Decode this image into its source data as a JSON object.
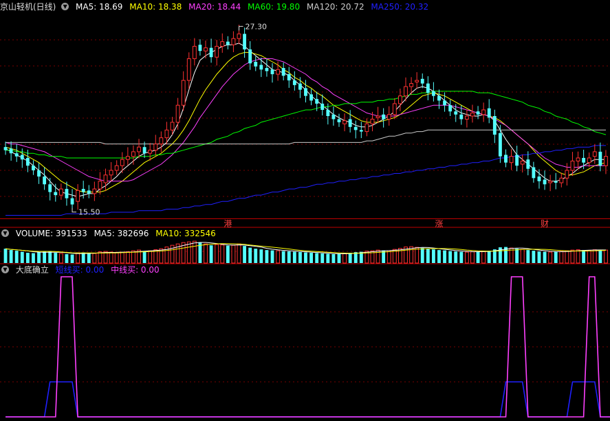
{
  "colors": {
    "background": "#000000",
    "up": "#ff3232",
    "down": "#54ffff",
    "grid": "#8b0000",
    "ma5": "#ffffff",
    "ma10": "#ffff00",
    "ma20": "#ff40ff",
    "ma60": "#00ff00",
    "ma120": "#cccccc",
    "ma250": "#2020ff",
    "short_buy": "#2020ff",
    "mid_buy": "#ff40ff",
    "tag": "#ff4040"
  },
  "price_panel": {
    "title": "京山轻机(日线)",
    "legend": [
      {
        "key": "ma5",
        "label": "MA5: 18.69",
        "color": "#ffffff"
      },
      {
        "key": "ma10",
        "label": "MA10: 18.38",
        "color": "#ffff00"
      },
      {
        "key": "ma20",
        "label": "MA20: 18.44",
        "color": "#ff40ff"
      },
      {
        "key": "ma60",
        "label": "MA60: 19.80",
        "color": "#00ff00"
      },
      {
        "key": "ma120",
        "label": "MA120: 20.72",
        "color": "#cccccc"
      },
      {
        "key": "ma250",
        "label": "MA250: 20.32",
        "color": "#2020ff"
      }
    ],
    "high_label": "27.30",
    "low_label": "15.50",
    "tags": [
      "港",
      "涨",
      "财"
    ]
  },
  "volume_panel": {
    "legend": [
      {
        "key": "volume",
        "label": "VOLUME: 391533",
        "color": "#ffffff"
      },
      {
        "key": "vma5",
        "label": "MA5: 382696",
        "color": "#ffffff"
      },
      {
        "key": "vma10",
        "label": "MA10: 332546",
        "color": "#ffff00"
      }
    ]
  },
  "indicator_panel": {
    "title": "大底确立",
    "legend": [
      {
        "key": "short_buy",
        "label": "短线买: 0.00",
        "color": "#2020ff"
      },
      {
        "key": "mid_buy",
        "label": "中线买: 0.00",
        "color": "#ff40ff"
      }
    ]
  },
  "chart_data": {
    "type": "candlestick",
    "price": {
      "high": 27.3,
      "low": 15.5,
      "ylim": [
        15.0,
        28.2
      ],
      "closes": [
        19.4,
        19.2,
        19.0,
        18.8,
        18.4,
        18.1,
        17.7,
        17.2,
        16.7,
        16.5,
        16.9,
        16.3,
        15.9,
        16.8,
        16.7,
        16.6,
        16.9,
        17.4,
        17.8,
        18.1,
        18.4,
        18.8,
        19.0,
        19.3,
        19.6,
        19.2,
        19.4,
        19.8,
        20.2,
        20.7,
        21.2,
        22.3,
        23.9,
        25.3,
        26.1,
        25.8,
        26.0,
        25.4,
        26.1,
        26.4,
        26.2,
        26.6,
        26.9,
        25.9,
        25.0,
        24.8,
        24.6,
        24.5,
        24.3,
        24.6,
        24.2,
        23.9,
        23.6,
        23.3,
        22.9,
        22.6,
        22.4,
        22.0,
        21.6,
        21.4,
        21.2,
        21.3,
        20.9,
        20.7,
        20.6,
        21.1,
        21.4,
        21.6,
        21.4,
        21.7,
        22.4,
        22.9,
        23.5,
        23.7,
        23.9,
        23.7,
        23.1,
        22.9,
        22.6,
        22.3,
        21.9,
        21.7,
        21.4,
        21.6,
        21.8,
        21.7,
        22.0,
        21.5,
        20.4,
        19.0,
        18.6,
        19.0,
        18.4,
        18.7,
        18.2,
        17.6,
        17.4,
        17.2,
        17.4,
        17.3,
        17.6,
        18.1,
        18.7,
        18.9,
        18.6,
        18.9,
        19.3,
        18.4,
        19.0
      ],
      "opens": [
        19.6,
        19.5,
        19.2,
        19.1,
        18.9,
        18.4,
        18.1,
        17.7,
        17.2,
        16.7,
        16.5,
        16.9,
        16.3,
        16.1,
        16.9,
        16.8,
        16.6,
        16.9,
        17.3,
        17.8,
        18.1,
        18.4,
        18.8,
        19.0,
        19.3,
        19.6,
        19.2,
        19.4,
        19.8,
        20.2,
        20.7,
        21.2,
        22.3,
        23.9,
        25.3,
        26.2,
        25.8,
        26.0,
        25.4,
        26.1,
        26.4,
        26.2,
        26.6,
        26.9,
        25.9,
        25.1,
        24.9,
        24.7,
        24.6,
        24.3,
        24.7,
        24.3,
        23.9,
        23.7,
        23.4,
        23.0,
        22.7,
        22.4,
        22.0,
        21.7,
        21.4,
        21.1,
        21.4,
        20.9,
        20.7,
        20.6,
        21.1,
        21.5,
        21.7,
        21.4,
        21.7,
        22.4,
        22.9,
        23.5,
        23.8,
        24.0,
        23.7,
        23.2,
        22.9,
        22.6,
        22.3,
        21.9,
        21.7,
        21.4,
        21.6,
        21.9,
        21.7,
        22.1,
        21.6,
        20.5,
        19.1,
        18.6,
        19.1,
        18.5,
        18.8,
        18.3,
        17.7,
        17.5,
        17.3,
        17.4,
        17.3,
        17.6,
        18.1,
        18.7,
        18.9,
        18.6,
        19.0,
        19.3,
        18.4
      ],
      "ma": {
        "ma5": [
          19.5,
          19.3,
          19.1,
          18.9,
          18.7,
          18.4,
          18.1,
          17.8,
          17.4,
          17.0,
          16.7,
          16.6,
          16.5,
          16.4,
          16.5,
          16.6,
          16.6,
          16.9,
          17.1,
          17.4,
          17.7,
          18.1,
          18.4,
          18.7,
          19.0,
          19.2,
          19.3,
          19.4,
          19.6,
          19.9,
          20.4,
          21.1,
          22.1,
          23.3,
          24.4,
          25.2,
          25.5,
          25.7,
          25.9,
          26.1,
          26.2,
          26.2,
          26.3,
          26.1,
          25.8,
          25.5,
          25.2,
          24.9,
          24.6,
          24.5,
          24.4,
          24.2,
          23.9,
          23.6,
          23.3,
          22.9,
          22.6,
          22.3,
          22.0,
          21.7,
          21.5,
          21.3,
          21.2,
          21.0,
          20.9,
          20.9,
          21.0,
          21.2,
          21.4,
          21.6,
          21.9,
          22.3,
          22.7,
          23.1,
          23.4,
          23.5,
          23.4,
          23.2,
          22.9,
          22.6,
          22.3,
          22.0,
          21.8,
          21.7,
          21.6,
          21.6,
          21.7,
          21.6,
          21.3,
          20.7,
          20.1,
          19.6,
          19.1,
          18.8,
          18.5,
          18.2,
          17.9,
          17.6,
          17.4,
          17.4,
          17.5,
          17.7,
          17.9,
          18.2,
          18.4,
          18.6,
          18.8,
          18.8,
          18.8
        ],
        "ma10": [
          19.6,
          19.5,
          19.4,
          19.2,
          19.0,
          18.8,
          18.6,
          18.3,
          18.0,
          17.7,
          17.4,
          17.2,
          17.0,
          16.8,
          16.7,
          16.7,
          16.7,
          16.7,
          16.8,
          17.0,
          17.2,
          17.4,
          17.7,
          18.0,
          18.3,
          18.6,
          18.8,
          19.0,
          19.2,
          19.5,
          19.8,
          20.2,
          20.7,
          21.3,
          22.0,
          22.7,
          23.3,
          23.8,
          24.3,
          24.7,
          25.1,
          25.4,
          25.6,
          25.7,
          25.7,
          25.6,
          25.5,
          25.3,
          25.1,
          24.9,
          24.6,
          24.4,
          24.1,
          23.9,
          23.6,
          23.4,
          23.1,
          22.9,
          22.6,
          22.3,
          22.1,
          21.9,
          21.7,
          21.5,
          21.3,
          21.2,
          21.2,
          21.2,
          21.3,
          21.4,
          21.5,
          21.7,
          22.0,
          22.3,
          22.6,
          22.9,
          23.0,
          23.1,
          23.0,
          22.9,
          22.7,
          22.5,
          22.3,
          22.1,
          21.9,
          21.8,
          21.7,
          21.6,
          21.5,
          21.3,
          21.0,
          20.7,
          20.4,
          20.1,
          19.8,
          19.4,
          19.0,
          18.7,
          18.4,
          18.1,
          17.9,
          17.8,
          17.8,
          17.9,
          18.0,
          18.2,
          18.4,
          18.5,
          18.6
        ],
        "ma20": [
          19.9,
          19.8,
          19.8,
          19.7,
          19.6,
          19.5,
          19.4,
          19.3,
          19.1,
          18.9,
          18.7,
          18.5,
          18.3,
          18.1,
          17.9,
          17.7,
          17.6,
          17.5,
          17.4,
          17.4,
          17.4,
          17.4,
          17.4,
          17.5,
          17.7,
          17.9,
          18.1,
          18.3,
          18.5,
          18.8,
          19.1,
          19.5,
          19.9,
          20.4,
          20.9,
          21.5,
          22.0,
          22.5,
          23.0,
          23.5,
          23.9,
          24.3,
          24.6,
          24.9,
          25.1,
          25.2,
          25.3,
          25.3,
          25.3,
          25.2,
          25.1,
          24.9,
          24.7,
          24.5,
          24.3,
          24.0,
          23.8,
          23.5,
          23.3,
          23.0,
          22.8,
          22.6,
          22.4,
          22.2,
          22.0,
          21.8,
          21.7,
          21.6,
          21.6,
          21.6,
          21.6,
          21.7,
          21.8,
          21.9,
          22.0,
          22.1,
          22.2,
          22.3,
          22.3,
          22.3,
          22.3,
          22.2,
          22.1,
          22.0,
          21.9,
          21.8,
          21.7,
          21.6,
          21.4,
          21.2,
          21.0,
          20.7,
          20.4,
          20.1,
          19.8,
          19.5,
          19.2,
          18.9,
          18.7,
          18.5,
          18.4,
          18.3,
          18.3,
          18.3,
          18.4,
          18.4,
          18.4,
          18.4,
          18.4
        ],
        "ma60": [
          19.4,
          19.4,
          19.3,
          19.3,
          19.2,
          19.2,
          19.1,
          19.1,
          19.0,
          19.0,
          19.0,
          18.9,
          18.9,
          18.9,
          18.9,
          18.9,
          18.9,
          18.9,
          18.9,
          18.9,
          18.9,
          18.9,
          18.9,
          18.9,
          19.0,
          19.0,
          19.0,
          19.1,
          19.1,
          19.2,
          19.2,
          19.3,
          19.4,
          19.5,
          19.6,
          19.7,
          19.8,
          19.9,
          20.1,
          20.2,
          20.3,
          20.5,
          20.6,
          20.8,
          20.9,
          21.0,
          21.2,
          21.3,
          21.4,
          21.5,
          21.6,
          21.7,
          21.8,
          21.9,
          22.0,
          22.0,
          22.1,
          22.2,
          22.2,
          22.3,
          22.3,
          22.4,
          22.4,
          22.4,
          22.5,
          22.5,
          22.5,
          22.6,
          22.6,
          22.7,
          22.7,
          22.8,
          22.9,
          23.0,
          23.0,
          23.1,
          23.1,
          23.2,
          23.2,
          23.2,
          23.2,
          23.2,
          23.2,
          23.2,
          23.2,
          23.1,
          23.1,
          23.1,
          23.0,
          22.9,
          22.8,
          22.7,
          22.6,
          22.5,
          22.3,
          22.2,
          22.1,
          21.9,
          21.8,
          21.6,
          21.5,
          21.4,
          21.2,
          21.1,
          20.9,
          20.8,
          20.6,
          20.5,
          20.4
        ],
        "ma120": [
          19.9,
          19.9,
          19.9,
          19.9,
          19.9,
          19.9,
          19.9,
          19.9,
          19.9,
          19.9,
          19.9,
          19.9,
          19.9,
          19.9,
          19.9,
          19.9,
          19.9,
          19.9,
          19.8,
          19.8,
          19.8,
          19.8,
          19.8,
          19.8,
          19.8,
          19.8,
          19.8,
          19.8,
          19.8,
          19.8,
          19.8,
          19.8,
          19.8,
          19.8,
          19.8,
          19.8,
          19.8,
          19.8,
          19.8,
          19.8,
          19.8,
          19.8,
          19.8,
          19.8,
          19.8,
          19.8,
          19.8,
          19.8,
          19.8,
          19.8,
          19.8,
          19.8,
          19.9,
          19.9,
          19.9,
          19.9,
          19.9,
          19.9,
          19.9,
          19.9,
          19.9,
          19.9,
          19.9,
          19.9,
          19.9,
          20.0,
          20.0,
          20.1,
          20.2,
          20.3,
          20.3,
          20.4,
          20.5,
          20.5,
          20.6,
          20.6,
          20.7,
          20.7,
          20.7,
          20.7,
          20.7,
          20.7,
          20.7,
          20.7,
          20.7,
          20.7,
          20.7,
          20.7,
          20.7,
          20.7,
          20.7,
          20.7,
          20.7,
          20.7,
          20.7,
          20.7,
          20.7,
          20.7,
          20.7,
          20.7,
          20.7,
          20.7,
          20.7,
          20.7,
          20.7,
          20.7,
          20.7,
          20.7,
          20.7
        ],
        "ma250": [
          15.2,
          15.2,
          15.2,
          15.2,
          15.2,
          15.2,
          15.2,
          15.2,
          15.2,
          15.2,
          15.2,
          15.3,
          15.3,
          15.3,
          15.3,
          15.3,
          15.3,
          15.3,
          15.3,
          15.4,
          15.4,
          15.4,
          15.4,
          15.4,
          15.5,
          15.5,
          15.5,
          15.5,
          15.5,
          15.6,
          15.6,
          15.6,
          15.7,
          15.7,
          15.8,
          15.8,
          15.9,
          15.9,
          16.0,
          16.1,
          16.1,
          16.2,
          16.3,
          16.3,
          16.4,
          16.5,
          16.5,
          16.6,
          16.7,
          16.7,
          16.8,
          16.9,
          16.9,
          17.0,
          17.0,
          17.1,
          17.2,
          17.2,
          17.3,
          17.3,
          17.4,
          17.4,
          17.5,
          17.5,
          17.6,
          17.6,
          17.7,
          17.7,
          17.8,
          17.8,
          17.9,
          17.9,
          18.0,
          18.0,
          18.1,
          18.1,
          18.2,
          18.2,
          18.3,
          18.3,
          18.4,
          18.4,
          18.5,
          18.5,
          18.6,
          18.6,
          18.7,
          18.7,
          18.8,
          18.9,
          18.9,
          19.0,
          19.0,
          19.1,
          19.1,
          19.2,
          19.2,
          19.3,
          19.3,
          19.4,
          19.4,
          19.5,
          19.5,
          19.6,
          19.6,
          19.6,
          19.7,
          19.7,
          19.7
        ]
      }
    },
    "volume": {
      "values": [
        420,
        380,
        360,
        330,
        300,
        290,
        320,
        330,
        340,
        300,
        280,
        260,
        250,
        300,
        310,
        290,
        280,
        330,
        340,
        320,
        300,
        310,
        330,
        360,
        380,
        350,
        360,
        390,
        420,
        470,
        520,
        560,
        600,
        620,
        640,
        600,
        560,
        520,
        540,
        530,
        510,
        520,
        560,
        500,
        450,
        420,
        400,
        380,
        370,
        360,
        350,
        340,
        330,
        320,
        310,
        300,
        290,
        280,
        270,
        260,
        270,
        280,
        300,
        320,
        330,
        350,
        360,
        380,
        370,
        360,
        400,
        430,
        470,
        480,
        460,
        440,
        420,
        400,
        380,
        370,
        350,
        340,
        330,
        320,
        330,
        340,
        350,
        360,
        400,
        460,
        470,
        440,
        420,
        400,
        380,
        360,
        340,
        330,
        320,
        330,
        340,
        360,
        380,
        390,
        380,
        370,
        390,
        392,
        380
      ]
    },
    "indicator": {
      "ylim": [
        0,
        4
      ],
      "short_buy": [
        0,
        0,
        0,
        0,
        0,
        0,
        0,
        0,
        1,
        1,
        1,
        1,
        1,
        0,
        0,
        0,
        0,
        0,
        0,
        0,
        0,
        0,
        0,
        0,
        0,
        0,
        0,
        0,
        0,
        0,
        0,
        0,
        0,
        0,
        0,
        0,
        0,
        0,
        0,
        0,
        0,
        0,
        0,
        0,
        0,
        0,
        0,
        0,
        0,
        0,
        0,
        0,
        0,
        0,
        0,
        0,
        0,
        0,
        0,
        0,
        0,
        0,
        0,
        0,
        0,
        0,
        0,
        0,
        0,
        0,
        0,
        0,
        0,
        0,
        0,
        0,
        0,
        0,
        0,
        0,
        0,
        0,
        0,
        0,
        0,
        0,
        0,
        0,
        0,
        0,
        1,
        1,
        1,
        1,
        0,
        0,
        0,
        0,
        0,
        0,
        0,
        0,
        1,
        1,
        1,
        1,
        1,
        0,
        0,
        0,
        0
      ],
      "mid_buy": [
        0,
        0,
        0,
        0,
        0,
        0,
        0,
        0,
        0,
        0,
        4,
        4,
        4,
        0,
        0,
        0,
        0,
        0,
        0,
        0,
        0,
        0,
        0,
        0,
        0,
        0,
        0,
        0,
        0,
        0,
        0,
        0,
        0,
        0,
        0,
        0,
        0,
        0,
        0,
        0,
        0,
        0,
        0,
        0,
        0,
        0,
        0,
        0,
        0,
        0,
        0,
        0,
        0,
        0,
        0,
        0,
        0,
        0,
        0,
        0,
        0,
        0,
        0,
        0,
        0,
        0,
        0,
        0,
        0,
        0,
        0,
        0,
        0,
        0,
        0,
        0,
        0,
        0,
        0,
        0,
        0,
        0,
        0,
        0,
        0,
        0,
        0,
        0,
        0,
        0,
        0,
        4,
        4,
        4,
        0,
        0,
        0,
        0,
        0,
        0,
        0,
        0,
        0,
        0,
        0,
        4,
        4,
        0,
        0,
        0,
        0
      ]
    }
  }
}
